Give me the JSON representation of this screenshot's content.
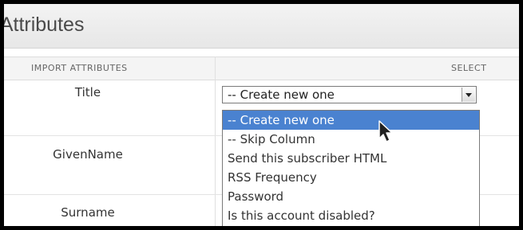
{
  "header": {
    "title": "rt Attributes"
  },
  "table": {
    "columns": {
      "attributes": "IMPORT ATTRIBUTES",
      "select": "SELECT"
    },
    "rows": [
      "Title",
      "GivenName",
      "Surname"
    ]
  },
  "select": {
    "value": "-- Create new one",
    "options": [
      "-- Create new one",
      "-- Skip Column",
      "Send this subscriber HTML",
      "RSS Frequency",
      "Password",
      "Is this account disabled?"
    ]
  },
  "colors": {
    "highlight": "#4a82d0"
  }
}
